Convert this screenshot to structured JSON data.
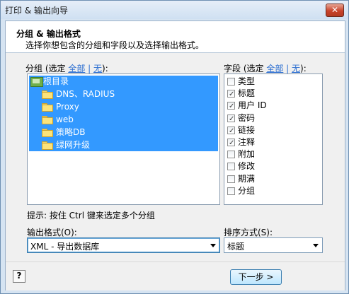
{
  "window": {
    "title": "打印 & 输出向导",
    "close": "✕"
  },
  "header": {
    "title": "分组 & 输出格式",
    "subtitle": "选择你想包含的分组和字段以及选择输出格式。"
  },
  "groups": {
    "label_prefix": "分组 (选定 ",
    "all": "全部",
    "sep": "|",
    "none": "无",
    "label_suffix": "):",
    "items": [
      "根目录",
      "DNS、RADIUS",
      "Proxy",
      "web",
      "策略DB",
      "绿网升级"
    ]
  },
  "fields": {
    "label_prefix": "字段 (选定 ",
    "all": "全部",
    "sep": "|",
    "none": "无",
    "label_suffix": "):",
    "items": [
      {
        "label": "类型",
        "checked": false
      },
      {
        "label": "标题",
        "checked": true
      },
      {
        "label": "用户 ID",
        "checked": true
      },
      {
        "label": "密码",
        "checked": true
      },
      {
        "label": "链接",
        "checked": true
      },
      {
        "label": "注释",
        "checked": true
      },
      {
        "label": "附加",
        "checked": false
      },
      {
        "label": "修改",
        "checked": false
      },
      {
        "label": "期满",
        "checked": false
      },
      {
        "label": "分组",
        "checked": false
      }
    ]
  },
  "hint": "提示: 按住 Ctrl 键来选定多个分组",
  "output": {
    "label": "输出格式(O):",
    "value": "XML - 导出数据库"
  },
  "sort": {
    "label": "排序方式(S):",
    "value": "标题"
  },
  "footer": {
    "help": "?",
    "next": "下一步 >"
  }
}
